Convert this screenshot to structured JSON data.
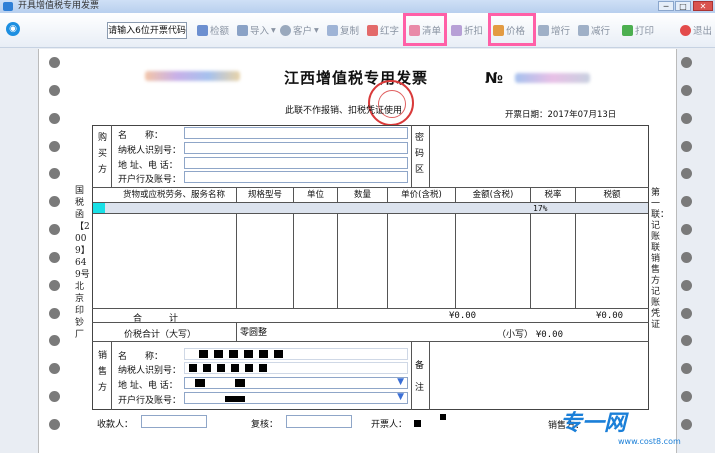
{
  "window": {
    "title": "开具增值税专用发票"
  },
  "toolbar": {
    "code_input_placeholder": "请输入6位开票代码",
    "buttons": {
      "recheck": "检额",
      "import": "导入",
      "customer": "客户",
      "copy": "复制",
      "red": "红字",
      "list": "清单",
      "discount": "折扣",
      "price": "价格",
      "add_row": "增行",
      "del_row": "减行",
      "print": "打印",
      "exit": "退出"
    }
  },
  "invoice": {
    "title": "江西增值税专用发票",
    "no_label": "№",
    "sub_note": "此联不作报销、扣税凭证使用",
    "date_label": "开票日期：",
    "date_value": "2017年07月13日",
    "left_vertical_print": "国税函【2009】649号北京印钞厂",
    "right_vertical_print": "第一联：记账联 销售方记账凭证",
    "buyer": {
      "side_label": "购买方",
      "name_label": "名　　称：",
      "taxid_label": "纳税人识别号：",
      "addr_label": "地 址、电 话：",
      "bank_label": "开户行及账号："
    },
    "password_area_label": "密码区",
    "columns": [
      "货物或应税劳务、服务名称",
      "规格型号",
      "单位",
      "数量",
      "单价(含税)",
      "金额(含税)",
      "税率",
      "税额"
    ],
    "first_row": {
      "tax_rate": "17%"
    },
    "total_label": "合　　　计",
    "total_amount": "¥0.00",
    "total_tax": "¥0.00",
    "price_tax_label": "价税合计（大写）",
    "price_tax_upper": "零圆整",
    "price_tax_lower_label": "（小写）",
    "price_tax_lower_value": "¥0.00",
    "seller": {
      "side_label": "销售方",
      "name_label": "名　　称：",
      "taxid_label": "纳税人识别号：",
      "addr_label": "地 址、电 话：",
      "bank_label": "开户行及账号："
    },
    "remark_label": "备注",
    "footer": {
      "payee_label": "收款人：",
      "reviewer_label": "复核：",
      "issuer_label": "开票人：",
      "seller_sign_label": "销售方："
    }
  },
  "watermark": {
    "brand": "专一网",
    "url": "www.cost8.com"
  },
  "colors": {
    "highlight": "#ff5fa7",
    "stamp": "#d93a3a",
    "row_marker": "#18e0e6"
  }
}
